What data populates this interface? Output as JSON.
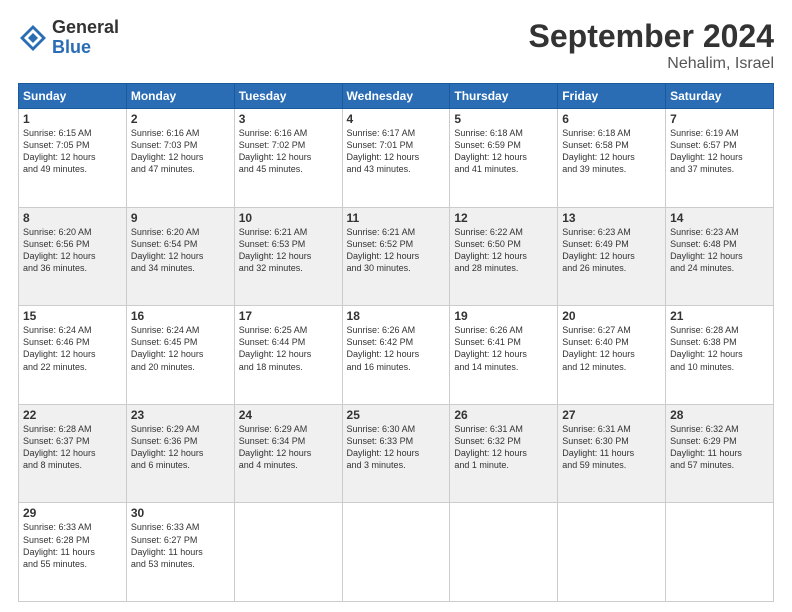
{
  "logo": {
    "general": "General",
    "blue": "Blue"
  },
  "title": "September 2024",
  "location": "Nehalim, Israel",
  "days_of_week": [
    "Sunday",
    "Monday",
    "Tuesday",
    "Wednesday",
    "Thursday",
    "Friday",
    "Saturday"
  ],
  "weeks": [
    [
      {
        "num": "1",
        "info": "Sunrise: 6:15 AM\nSunset: 7:05 PM\nDaylight: 12 hours\nand 49 minutes."
      },
      {
        "num": "2",
        "info": "Sunrise: 6:16 AM\nSunset: 7:03 PM\nDaylight: 12 hours\nand 47 minutes."
      },
      {
        "num": "3",
        "info": "Sunrise: 6:16 AM\nSunset: 7:02 PM\nDaylight: 12 hours\nand 45 minutes."
      },
      {
        "num": "4",
        "info": "Sunrise: 6:17 AM\nSunset: 7:01 PM\nDaylight: 12 hours\nand 43 minutes."
      },
      {
        "num": "5",
        "info": "Sunrise: 6:18 AM\nSunset: 6:59 PM\nDaylight: 12 hours\nand 41 minutes."
      },
      {
        "num": "6",
        "info": "Sunrise: 6:18 AM\nSunset: 6:58 PM\nDaylight: 12 hours\nand 39 minutes."
      },
      {
        "num": "7",
        "info": "Sunrise: 6:19 AM\nSunset: 6:57 PM\nDaylight: 12 hours\nand 37 minutes."
      }
    ],
    [
      {
        "num": "8",
        "info": "Sunrise: 6:20 AM\nSunset: 6:56 PM\nDaylight: 12 hours\nand 36 minutes."
      },
      {
        "num": "9",
        "info": "Sunrise: 6:20 AM\nSunset: 6:54 PM\nDaylight: 12 hours\nand 34 minutes."
      },
      {
        "num": "10",
        "info": "Sunrise: 6:21 AM\nSunset: 6:53 PM\nDaylight: 12 hours\nand 32 minutes."
      },
      {
        "num": "11",
        "info": "Sunrise: 6:21 AM\nSunset: 6:52 PM\nDaylight: 12 hours\nand 30 minutes."
      },
      {
        "num": "12",
        "info": "Sunrise: 6:22 AM\nSunset: 6:50 PM\nDaylight: 12 hours\nand 28 minutes."
      },
      {
        "num": "13",
        "info": "Sunrise: 6:23 AM\nSunset: 6:49 PM\nDaylight: 12 hours\nand 26 minutes."
      },
      {
        "num": "14",
        "info": "Sunrise: 6:23 AM\nSunset: 6:48 PM\nDaylight: 12 hours\nand 24 minutes."
      }
    ],
    [
      {
        "num": "15",
        "info": "Sunrise: 6:24 AM\nSunset: 6:46 PM\nDaylight: 12 hours\nand 22 minutes."
      },
      {
        "num": "16",
        "info": "Sunrise: 6:24 AM\nSunset: 6:45 PM\nDaylight: 12 hours\nand 20 minutes."
      },
      {
        "num": "17",
        "info": "Sunrise: 6:25 AM\nSunset: 6:44 PM\nDaylight: 12 hours\nand 18 minutes."
      },
      {
        "num": "18",
        "info": "Sunrise: 6:26 AM\nSunset: 6:42 PM\nDaylight: 12 hours\nand 16 minutes."
      },
      {
        "num": "19",
        "info": "Sunrise: 6:26 AM\nSunset: 6:41 PM\nDaylight: 12 hours\nand 14 minutes."
      },
      {
        "num": "20",
        "info": "Sunrise: 6:27 AM\nSunset: 6:40 PM\nDaylight: 12 hours\nand 12 minutes."
      },
      {
        "num": "21",
        "info": "Sunrise: 6:28 AM\nSunset: 6:38 PM\nDaylight: 12 hours\nand 10 minutes."
      }
    ],
    [
      {
        "num": "22",
        "info": "Sunrise: 6:28 AM\nSunset: 6:37 PM\nDaylight: 12 hours\nand 8 minutes."
      },
      {
        "num": "23",
        "info": "Sunrise: 6:29 AM\nSunset: 6:36 PM\nDaylight: 12 hours\nand 6 minutes."
      },
      {
        "num": "24",
        "info": "Sunrise: 6:29 AM\nSunset: 6:34 PM\nDaylight: 12 hours\nand 4 minutes."
      },
      {
        "num": "25",
        "info": "Sunrise: 6:30 AM\nSunset: 6:33 PM\nDaylight: 12 hours\nand 3 minutes."
      },
      {
        "num": "26",
        "info": "Sunrise: 6:31 AM\nSunset: 6:32 PM\nDaylight: 12 hours\nand 1 minute."
      },
      {
        "num": "27",
        "info": "Sunrise: 6:31 AM\nSunset: 6:30 PM\nDaylight: 11 hours\nand 59 minutes."
      },
      {
        "num": "28",
        "info": "Sunrise: 6:32 AM\nSunset: 6:29 PM\nDaylight: 11 hours\nand 57 minutes."
      }
    ],
    [
      {
        "num": "29",
        "info": "Sunrise: 6:33 AM\nSunset: 6:28 PM\nDaylight: 11 hours\nand 55 minutes."
      },
      {
        "num": "30",
        "info": "Sunrise: 6:33 AM\nSunset: 6:27 PM\nDaylight: 11 hours\nand 53 minutes."
      },
      null,
      null,
      null,
      null,
      null
    ]
  ]
}
